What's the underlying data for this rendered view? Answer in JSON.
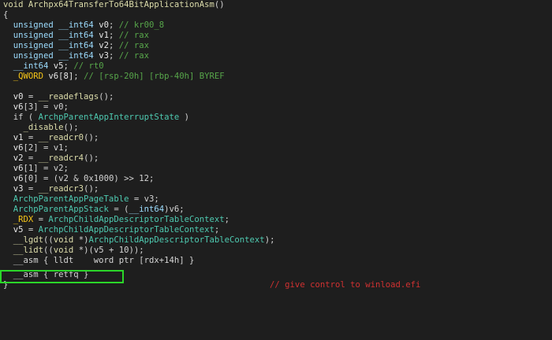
{
  "lines": [
    {
      "parts": [
        {
          "c": "kw",
          "t": "void "
        },
        {
          "c": "fn",
          "t": "Archpx64TransferTo64BitApplicationAsm"
        },
        {
          "c": "txt",
          "t": "()"
        }
      ]
    },
    {
      "parts": [
        {
          "c": "txt",
          "t": "{"
        }
      ]
    },
    {
      "parts": [
        {
          "c": "ty",
          "t": "  unsigned __int64 "
        },
        {
          "c": "var",
          "t": "v0"
        },
        {
          "c": "txt",
          "t": "; "
        },
        {
          "c": "cm",
          "t": "// kr00_8"
        }
      ]
    },
    {
      "parts": [
        {
          "c": "ty",
          "t": "  unsigned __int64 "
        },
        {
          "c": "var",
          "t": "v1"
        },
        {
          "c": "txt",
          "t": "; "
        },
        {
          "c": "cm",
          "t": "// rax"
        }
      ]
    },
    {
      "parts": [
        {
          "c": "ty",
          "t": "  unsigned __int64 "
        },
        {
          "c": "var",
          "t": "v2"
        },
        {
          "c": "txt",
          "t": "; "
        },
        {
          "c": "cm",
          "t": "// rax"
        }
      ]
    },
    {
      "parts": [
        {
          "c": "ty",
          "t": "  unsigned __int64 "
        },
        {
          "c": "var",
          "t": "v3"
        },
        {
          "c": "txt",
          "t": "; "
        },
        {
          "c": "cm",
          "t": "// rax"
        }
      ]
    },
    {
      "parts": [
        {
          "c": "ty",
          "t": "  __int64 "
        },
        {
          "c": "var",
          "t": "v5"
        },
        {
          "c": "txt",
          "t": "; "
        },
        {
          "c": "cm",
          "t": "// rt0"
        }
      ]
    },
    {
      "parts": [
        {
          "c": "reg",
          "t": "  _QWORD "
        },
        {
          "c": "var",
          "t": "v6[8]"
        },
        {
          "c": "txt",
          "t": "; "
        },
        {
          "c": "cm",
          "t": "// [rsp-20h] [rbp-40h] BYREF"
        }
      ]
    },
    {
      "parts": [
        {
          "c": "txt",
          "t": ""
        }
      ]
    },
    {
      "parts": [
        {
          "c": "var",
          "t": "  v0"
        },
        {
          "c": "txt",
          "t": " = "
        },
        {
          "c": "fn",
          "t": "__readeflags"
        },
        {
          "c": "txt",
          "t": "();"
        }
      ]
    },
    {
      "parts": [
        {
          "c": "var",
          "t": "  v6"
        },
        {
          "c": "txt",
          "t": "[3] = v0;"
        }
      ]
    },
    {
      "parts": [
        {
          "c": "txt",
          "t": "  if ( "
        },
        {
          "c": "gvar",
          "t": "ArchpParentAppInterruptState"
        },
        {
          "c": "txt",
          "t": " )"
        }
      ]
    },
    {
      "parts": [
        {
          "c": "fn",
          "t": "    _disable"
        },
        {
          "c": "txt",
          "t": "();"
        }
      ]
    },
    {
      "parts": [
        {
          "c": "var",
          "t": "  v1"
        },
        {
          "c": "txt",
          "t": " = "
        },
        {
          "c": "fn",
          "t": "__readcr0"
        },
        {
          "c": "txt",
          "t": "();"
        }
      ]
    },
    {
      "parts": [
        {
          "c": "var",
          "t": "  v6"
        },
        {
          "c": "txt",
          "t": "[2] = v1;"
        }
      ]
    },
    {
      "parts": [
        {
          "c": "var",
          "t": "  v2"
        },
        {
          "c": "txt",
          "t": " = "
        },
        {
          "c": "fn",
          "t": "__readcr4"
        },
        {
          "c": "txt",
          "t": "();"
        }
      ]
    },
    {
      "parts": [
        {
          "c": "var",
          "t": "  v6"
        },
        {
          "c": "txt",
          "t": "[1] = v2;"
        }
      ]
    },
    {
      "parts": [
        {
          "c": "var",
          "t": "  v6"
        },
        {
          "c": "txt",
          "t": "[0] = (v2 & 0x1000) >> 12;"
        }
      ]
    },
    {
      "parts": [
        {
          "c": "var",
          "t": "  v3"
        },
        {
          "c": "txt",
          "t": " = "
        },
        {
          "c": "fn",
          "t": "__readcr3"
        },
        {
          "c": "txt",
          "t": "();"
        }
      ]
    },
    {
      "parts": [
        {
          "c": "gvar",
          "t": "  ArchpParentAppPageTable"
        },
        {
          "c": "txt",
          "t": " = v3;"
        }
      ]
    },
    {
      "parts": [
        {
          "c": "gvar",
          "t": "  ArchpParentAppStack"
        },
        {
          "c": "txt",
          "t": " = ("
        },
        {
          "c": "ty",
          "t": "__int64"
        },
        {
          "c": "txt",
          "t": ")v6;"
        }
      ]
    },
    {
      "parts": [
        {
          "c": "reg",
          "t": "  _RDX"
        },
        {
          "c": "txt",
          "t": " = "
        },
        {
          "c": "gvar",
          "t": "ArchpChildAppDescriptorTableContext"
        },
        {
          "c": "txt",
          "t": ";"
        }
      ]
    },
    {
      "parts": [
        {
          "c": "var",
          "t": "  v5"
        },
        {
          "c": "txt",
          "t": " = "
        },
        {
          "c": "gvar",
          "t": "ArchpChildAppDescriptorTableContext"
        },
        {
          "c": "txt",
          "t": ";"
        }
      ]
    },
    {
      "parts": [
        {
          "c": "fn",
          "t": "  __lgdt"
        },
        {
          "c": "txt",
          "t": "(("
        },
        {
          "c": "kw",
          "t": "void"
        },
        {
          "c": "txt",
          "t": " *)"
        },
        {
          "c": "gvar",
          "t": "ArchpChildAppDescriptorTableContext"
        },
        {
          "c": "txt",
          "t": ");"
        }
      ]
    },
    {
      "parts": [
        {
          "c": "fn",
          "t": "  __lidt"
        },
        {
          "c": "txt",
          "t": "(("
        },
        {
          "c": "kw",
          "t": "void"
        },
        {
          "c": "txt",
          "t": " *)(v5 + 10));"
        }
      ]
    },
    {
      "parts": [
        {
          "c": "txt",
          "t": "  __asm { lldt    word ptr [rdx+14h] }"
        }
      ]
    },
    {
      "parts": [
        {
          "c": "txt",
          "t": "  __asm { retfq }"
        }
      ]
    },
    {
      "parts": [
        {
          "c": "txt",
          "t": "}"
        },
        {
          "c": "txt",
          "t": "                                                    "
        },
        {
          "c": "cm2",
          "t": "// give control to winload.efi"
        }
      ]
    }
  ]
}
